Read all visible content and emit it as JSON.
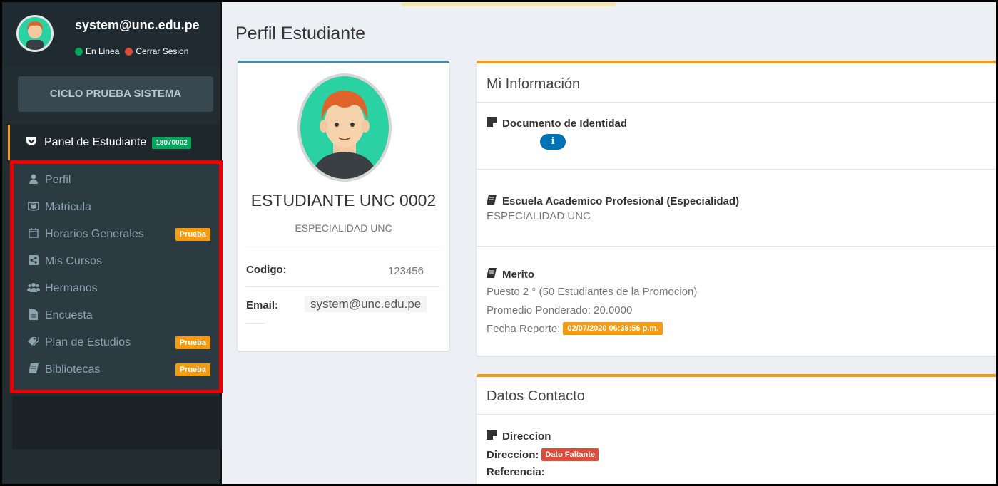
{
  "sidebar": {
    "user_email": "system@unc.edu.pe",
    "status_online": "En Linea",
    "status_logout": "Cerrar Sesion",
    "ciclo_label": "CICLO PRUEBA SISTEMA",
    "panel_label": "Panel de Estudiante",
    "panel_badge": "18070002",
    "items": [
      {
        "label": "Perfil",
        "icon": "user-icon",
        "badge": ""
      },
      {
        "label": "Matricula",
        "icon": "book-open-icon",
        "badge": ""
      },
      {
        "label": "Horarios Generales",
        "icon": "calendar-icon",
        "badge": "Prueba"
      },
      {
        "label": "Mis Cursos",
        "icon": "share-icon",
        "badge": ""
      },
      {
        "label": "Hermanos",
        "icon": "users-icon",
        "badge": ""
      },
      {
        "label": "Encuesta",
        "icon": "file-icon",
        "badge": ""
      },
      {
        "label": "Plan de Estudios",
        "icon": "tag-icon",
        "badge": "Prueba"
      },
      {
        "label": "Bibliotecas",
        "icon": "book-icon",
        "badge": "Prueba"
      }
    ],
    "colors": {
      "online": "#00a65a",
      "logout": "#dd4b39",
      "badge": "#f39c12",
      "highlight": "#e00000"
    }
  },
  "main": {
    "page_title": "Perfil Estudiante",
    "profile": {
      "name": "ESTUDIANTE UNC 0002",
      "specialty": "ESPECIALIDAD UNC",
      "codigo_label": "Codigo:",
      "codigo_value": "123456",
      "email_label": "Email:",
      "email_value": "system@unc.edu.pe"
    },
    "info": {
      "title": "Mi Información",
      "doc_title": "Documento de Identidad",
      "doc_button": "i",
      "escuela_title": "Escuela Academico Profesional (Especialidad)",
      "escuela_value": "ESPECIALIDAD UNC",
      "merito_title": "Merito",
      "merito_puesto": "Puesto 2 ° (50 Estudiantes de la Promocion)",
      "merito_promedio": "Promedio Ponderado: 20.0000",
      "fecha_label": "Fecha Reporte:",
      "fecha_value": "02/07/2020 06:38:56 p.m."
    },
    "contact": {
      "title": "Datos Contacto",
      "direccion_title": "Direccion",
      "direccion_label": "Direccion:",
      "direccion_badge": "Dato Faltante",
      "referencia_label": "Referencia:"
    }
  }
}
